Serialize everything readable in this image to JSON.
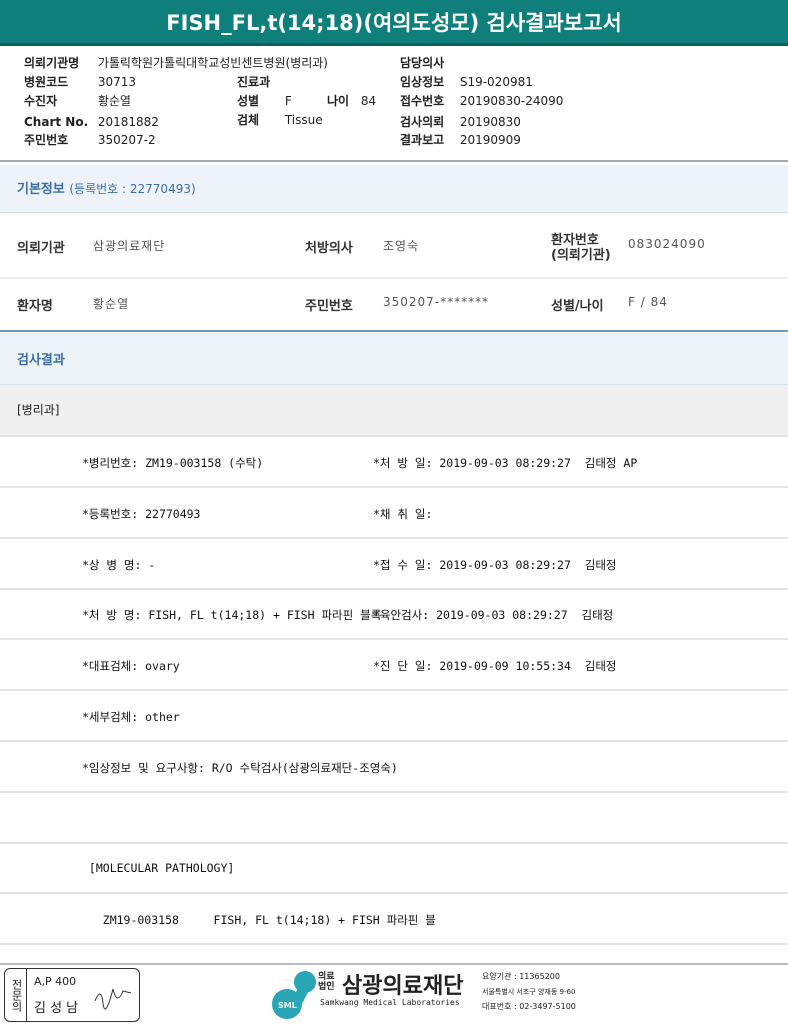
{
  "title": "FISH_FL,t(14;18)(여의도성모) 검사결과보고서",
  "header": {
    "req_inst_label": "의뢰기관명",
    "req_inst": "가톨릭학원가톨릭대학교성빈센트병원(병리과)",
    "doctor_label": "담당의사",
    "hosp_code_label": "병원코드",
    "hosp_code": "30713",
    "dept_label": "진료과",
    "clinical_label": "임상정보",
    "clinical": "S19-020981",
    "patient_label": "수진자",
    "patient": "황순열",
    "sex_label": "성별",
    "sex": "F",
    "age_label": "나이",
    "age": "84",
    "receipt_label": "접수번호",
    "receipt": "20190830-24090",
    "chart_label": "Chart No.",
    "chart": "20181882",
    "specimen_label": "검체",
    "specimen": "Tissue",
    "request_label": "검사의뢰",
    "request": "20190830",
    "id_label": "주민번호",
    "id": "350207-2",
    "report_label": "결과보고",
    "report": "20190909"
  },
  "basic": {
    "title": "기본정보",
    "reg": "(등록번호 : 22770493)",
    "inst_label": "의뢰기관",
    "inst": "삼광의료재단",
    "presc_label": "처방의사",
    "presc": "조영숙",
    "pno_label1": "환자번호",
    "pno_label2": "(의뢰기관)",
    "pno": "083024090",
    "name_label": "환자명",
    "name": "황순열",
    "rrn_label": "주민번호",
    "rrn": "350207-*******",
    "sexage_label": "성별/나이",
    "sexage": "F / 84"
  },
  "results": {
    "title": "검사결과",
    "dept": "[병리과]",
    "rows": [
      {
        "l": "*병리번호: ZM19-003158 (수탁)",
        "r": "*처 방 일: 2019-09-03 08:29:27  김태정 AP"
      },
      {
        "l": "*등록번호: 22770493",
        "r": "*채 취 일:"
      },
      {
        "l": "*상 병 명: -",
        "r": "*접 수 일: 2019-09-03 08:29:27  김태정"
      },
      {
        "l": "*처 방 명: FISH, FL t(14;18) + FISH 파라핀 블록",
        "r": "*육안검사: 2019-09-03 08:29:27  김태정"
      },
      {
        "l": "*대표검체: ovary",
        "r": "*진 단 일: 2019-09-09 10:55:34  김태정"
      },
      {
        "l": "*세부검체: other",
        "r": ""
      },
      {
        "l": "*임상정보 및 요구사항: R/O 수탁검사(삼광의료재단-조영숙)",
        "r": ""
      },
      {
        "l": "",
        "r": ""
      },
      {
        "l": " [MOLECULAR PATHOLOGY]",
        "r": ""
      },
      {
        "l": "   ZM19-003158     FISH, FL t(14;18) + FISH 파라핀 블",
        "r": ""
      }
    ]
  },
  "footer": {
    "stamp_side": "전문의",
    "stamp_code": "A,P 400",
    "stamp_name": "김 성 남",
    "signature": "signature",
    "logo_small1": "의료",
    "logo_small2": "법인",
    "logo_main": "삼광의료재단",
    "logo_sml": "SML",
    "logo_en": "Samkwang Medical Laboratories",
    "code": "요양기관 : 11365200",
    "addr": "서울특별시 서초구 양재동 9-60",
    "tel": "대표번호 : 02-3497-5100"
  }
}
